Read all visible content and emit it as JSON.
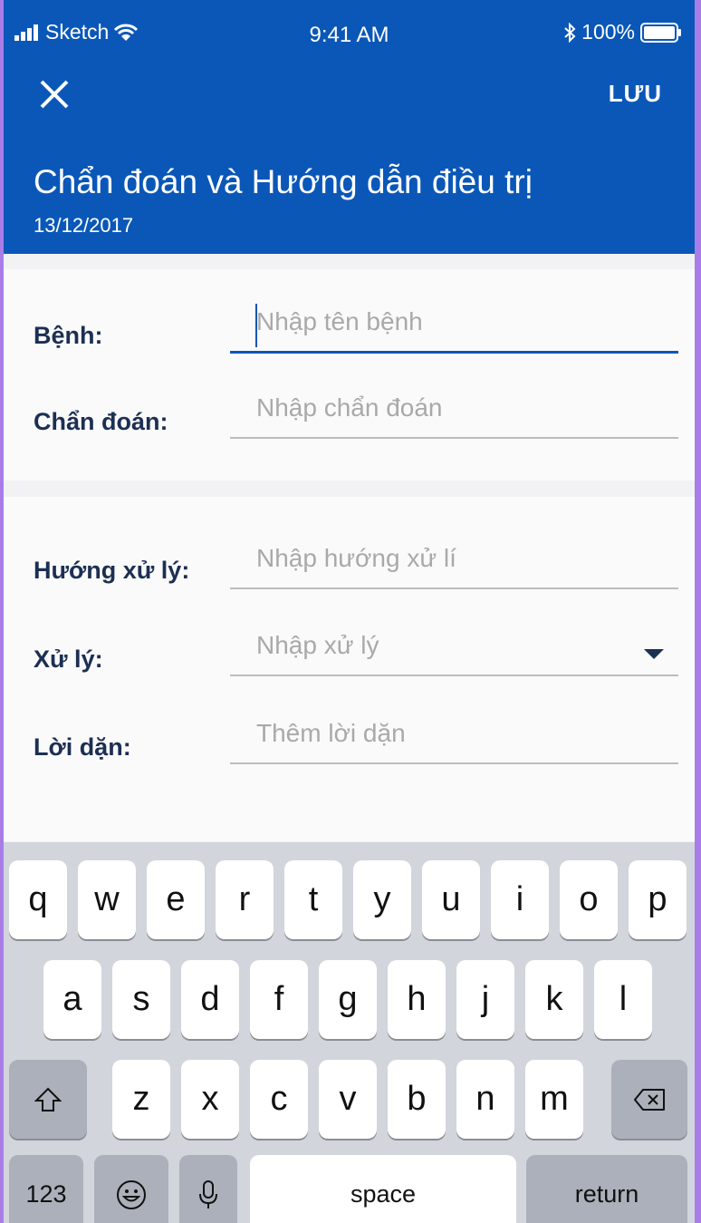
{
  "status_bar": {
    "carrier": "Sketch",
    "time": "9:41 AM",
    "battery": "100%"
  },
  "header": {
    "close_icon": "close-icon",
    "save_label": "LƯU",
    "title": "Chẩn đoán và Hướng dẫn điều trị",
    "date": "13/12/2017"
  },
  "form": {
    "disease": {
      "label": "Bệnh:",
      "placeholder": "Nhập tên bệnh"
    },
    "diagnosis": {
      "label": "Chẩn đoán:",
      "placeholder": "Nhập chẩn đoán"
    },
    "direction": {
      "label": "Hướng xử lý:",
      "placeholder": "Nhập hướng xử lí"
    },
    "treatment": {
      "label": "Xử lý:",
      "placeholder": "Nhập xử lý"
    },
    "advice": {
      "label": "Lời dặn:",
      "placeholder": "Thêm lời dặn"
    }
  },
  "keyboard": {
    "row1": [
      "q",
      "w",
      "e",
      "r",
      "t",
      "y",
      "u",
      "i",
      "o",
      "p"
    ],
    "row2": [
      "a",
      "s",
      "d",
      "f",
      "g",
      "h",
      "j",
      "k",
      "l"
    ],
    "row3": [
      "z",
      "x",
      "c",
      "v",
      "b",
      "n",
      "m"
    ],
    "numbers": "123",
    "space": "space",
    "return": "return"
  }
}
